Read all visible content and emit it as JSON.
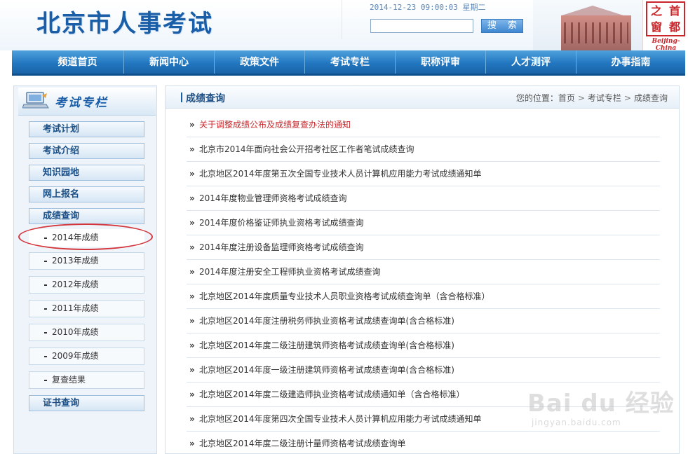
{
  "header": {
    "site_title": "北京市人事考试",
    "datetime": "2014-12-23 09:00:03 星期二",
    "search_button": "搜 索",
    "logo_chars": [
      "之",
      "首",
      "窗",
      "都"
    ],
    "logo_subtitle": "Beijing-China"
  },
  "nav": {
    "items": [
      "频道首页",
      "新闻中心",
      "政策文件",
      "考试专栏",
      "职称评审",
      "人才测评",
      "办事指南"
    ]
  },
  "sidebar": {
    "title": "考试专栏",
    "items": [
      "考试计划",
      "考试介绍",
      "知识园地",
      "网上报名",
      "成绩查询"
    ],
    "sub_items": [
      "2014年成绩",
      "2013年成绩",
      "2012年成绩",
      "2011年成绩",
      "2010年成绩",
      "2009年成绩",
      "复查结果"
    ],
    "cert_item": "证书查询",
    "highlighted_sub_item": "2014年成绩"
  },
  "content": {
    "title": "成绩查询",
    "breadcrumb": {
      "prefix": "您的位置：",
      "home": "首页",
      "section": "考试专栏",
      "current": "成绩查询"
    },
    "list": [
      "关于调整成绩公布及成绩复查办法的通知",
      "北京市2014年面向社会公开招考社区工作者笔试成绩查询",
      "北京地区2014年度第五次全国专业技术人员计算机应用能力考试成绩通知单",
      "2014年度物业管理师资格考试成绩查询",
      "2014年度价格鉴证师执业资格考试成绩查询",
      "2014年度注册设备监理师资格考试成绩查询",
      "2014年度注册安全工程师执业资格考试成绩查询",
      "北京地区2014年度质量专业技术人员职业资格考试成绩查询单（含合格标准）",
      "北京地区2014年度注册税务师执业资格考试成绩查询单(含合格标准)",
      "北京地区2014年度二级注册建筑师资格考试成绩查询单(含合格标准)",
      "北京地区2014年度一级注册建筑师资格考试成绩查询单(含合格标准)",
      "北京地区2014年度二级建造师执业资格考试成绩通知单（含合格标准）",
      "北京地区2014年度第四次全国专业技术人员计算机应用能力考试成绩通知单",
      "北京地区2014年度二级注册计量师资格考试成绩查询单"
    ],
    "list_arrow": "»"
  },
  "watermark": {
    "main": "Bai du 经验",
    "url": "jingyan.baidu.com"
  },
  "colors": {
    "accent": "#1b5ea8",
    "nav_bg": "#2277c0",
    "notice_red": "#c8262a",
    "highlight_ring": "#d4353b"
  }
}
